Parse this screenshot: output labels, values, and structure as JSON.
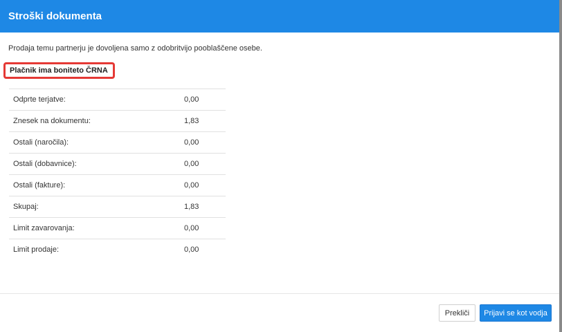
{
  "dialog": {
    "title": "Stroški dokumenta",
    "message": "Prodaja temu partnerju je dovoljena samo z odobritvijo pooblaščene osebe.",
    "alert": "Plačnik ima boniteto ČRNA",
    "rows": [
      {
        "label": "Odprte terjatve:",
        "value": "0,00"
      },
      {
        "label": "Znesek na dokumentu:",
        "value": "1,83"
      },
      {
        "label": "Ostali (naročila):",
        "value": "0,00"
      },
      {
        "label": "Ostali (dobavnice):",
        "value": "0,00"
      },
      {
        "label": "Ostali (fakture):",
        "value": "0,00"
      },
      {
        "label": "Skupaj:",
        "value": "1,83"
      },
      {
        "label": "Limit zavarovanja:",
        "value": "0,00"
      },
      {
        "label": "Limit prodaje:",
        "value": "0,00"
      }
    ],
    "buttons": {
      "cancel": "Prekliči",
      "primary": "Prijavi se kot vodja"
    }
  },
  "colors": {
    "header": "#1e88e5",
    "alert_border": "#e53935",
    "primary_button": "#1e88e5"
  }
}
